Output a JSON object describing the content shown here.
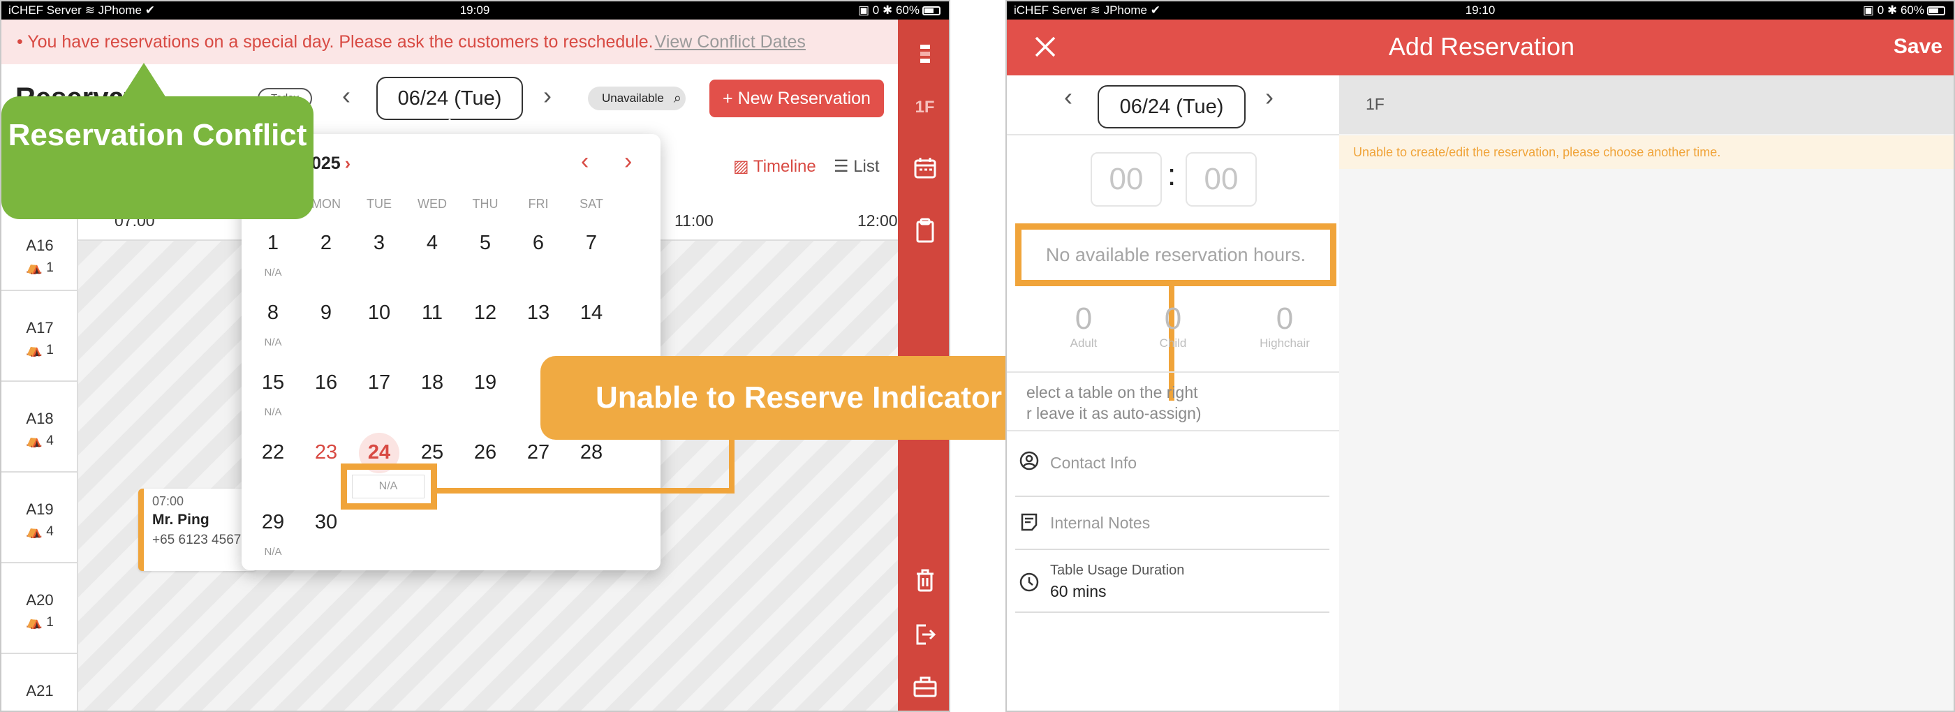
{
  "left": {
    "status": {
      "carrier": "iCHEF Server",
      "wifi": "JPhome",
      "time": "19:09",
      "right": "0",
      "battery": "60%"
    },
    "alert": {
      "message": "• You have reservations on a special day. Please ask the customers to reschedule.",
      "link": "View Conflict Dates"
    },
    "toolbar": {
      "title": "Reservati",
      "today": "Today",
      "date": "06/24 (Tue)",
      "unavailable": "Unavailable",
      "new_reservation": "+ New Reservation"
    },
    "rail": {
      "floor": "1F"
    },
    "view": {
      "timeline": "Timeline",
      "list": "List"
    },
    "time_labels": [
      "07:00",
      "11:00",
      "12:00"
    ],
    "tables": [
      {
        "name": "A16",
        "seats": "1"
      },
      {
        "name": "A17",
        "seats": "1"
      },
      {
        "name": "A18",
        "seats": "4"
      },
      {
        "name": "A19",
        "seats": "4"
      },
      {
        "name": "A20",
        "seats": "1"
      },
      {
        "name": "A21",
        "seats": ""
      }
    ],
    "reservation_card": {
      "time": "07:00",
      "name": "Mr. Ping",
      "phone": "+65 6123 4567"
    },
    "calendar": {
      "month": "025",
      "weekdays": [
        "MON",
        "TUE",
        "WED",
        "THU",
        "FRI",
        "SAT"
      ],
      "weeks": [
        [
          "1",
          "2",
          "3",
          "4",
          "5",
          "6",
          "7"
        ],
        [
          "8",
          "9",
          "10",
          "11",
          "12",
          "13",
          "14"
        ],
        [
          "15",
          "16",
          "17",
          "18",
          "19",
          "",
          ""
        ],
        [
          "22",
          "23",
          "24",
          "25",
          "26",
          "27",
          "28"
        ],
        [
          "29",
          "30",
          "",
          "",
          "",
          "",
          ""
        ]
      ],
      "na": "N/A"
    },
    "callout_conflict": "Reservation Conflict"
  },
  "callout_unable": "Unable to Reserve Indicator",
  "right": {
    "status": {
      "carrier": "iCHEF Server",
      "wifi": "JPhome",
      "time": "19:10",
      "right": "0",
      "battery": "60%"
    },
    "header": {
      "title": "Add Reservation",
      "save": "Save"
    },
    "date": "06/24 (Tue)",
    "floor": "1F",
    "warning": "Unable to create/edit the reservation, please choose another time.",
    "hour": "00",
    "minute": "00",
    "colon": ":",
    "no_hours": "No available reservation hours.",
    "counters": [
      {
        "value": "0",
        "label": "Adult"
      },
      {
        "value": "0",
        "label": "Child"
      },
      {
        "value": "0",
        "label": "Highchair"
      }
    ],
    "table_hint_1": "elect a table on the right",
    "table_hint_2": "r leave it as auto-assign)",
    "contact": "Contact Info",
    "notes": "Internal Notes",
    "duration_label": "Table Usage Duration",
    "duration_value": "60 mins"
  }
}
